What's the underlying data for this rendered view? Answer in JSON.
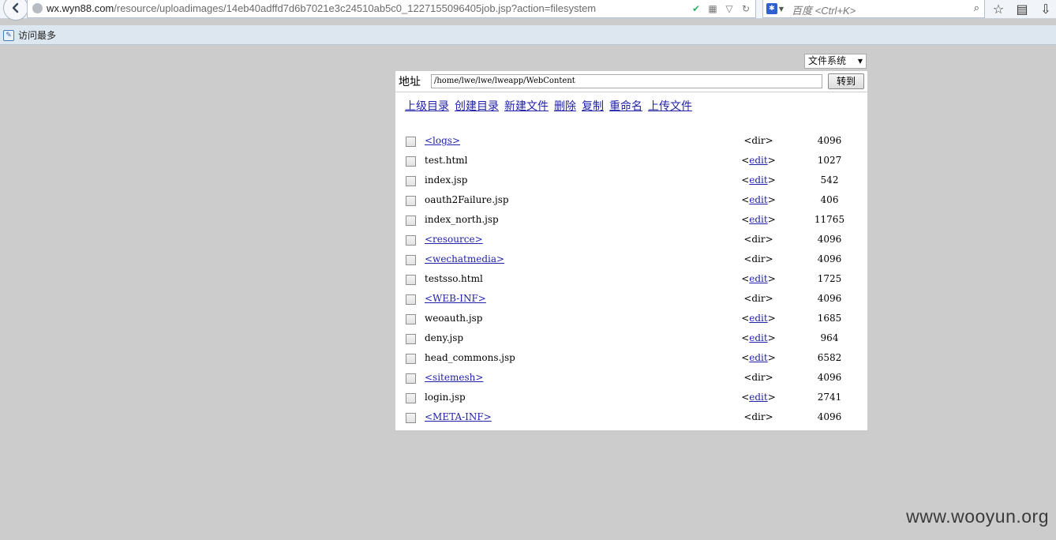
{
  "browser": {
    "url_domain": "wx.wyn88.com",
    "url_path": "/resource/uploadimages/14eb40adffd7d6b7021e3c24510ab5c0_1227155096405job.jsp?action=filesystem",
    "search_placeholder": "百度 <Ctrl+K>",
    "bookmark_label": "访问最多"
  },
  "filesystem": {
    "mode_select": "文件系统",
    "address_label": "地址",
    "address_value": "/home/lwe/lwe/lweapp/WebContent",
    "go_button": "转到",
    "actions": [
      "上级目录",
      "创建目录",
      "新建文件",
      "删除",
      "复制",
      "重命名",
      "上传文件"
    ],
    "files": [
      {
        "name": "<logs>",
        "is_dir": true,
        "type_prefix": "",
        "type_text": "<dir>",
        "type_suffix": "",
        "size": "4096"
      },
      {
        "name": "test.html",
        "is_dir": false,
        "type_prefix": "<",
        "type_text": "edit",
        "type_suffix": ">",
        "size": "1027"
      },
      {
        "name": "index.jsp",
        "is_dir": false,
        "type_prefix": "<",
        "type_text": "edit",
        "type_suffix": ">",
        "size": "542"
      },
      {
        "name": "oauth2Failure.jsp",
        "is_dir": false,
        "type_prefix": "<",
        "type_text": "edit",
        "type_suffix": ">",
        "size": "406"
      },
      {
        "name": "index_north.jsp",
        "is_dir": false,
        "type_prefix": "<",
        "type_text": "edit",
        "type_suffix": ">",
        "size": "11765"
      },
      {
        "name": "<resource>",
        "is_dir": true,
        "type_prefix": "",
        "type_text": "<dir>",
        "type_suffix": "",
        "size": "4096"
      },
      {
        "name": "<wechatmedia>",
        "is_dir": true,
        "type_prefix": "",
        "type_text": "<dir>",
        "type_suffix": "",
        "size": "4096"
      },
      {
        "name": "testsso.html",
        "is_dir": false,
        "type_prefix": "<",
        "type_text": "edit",
        "type_suffix": ">",
        "size": "1725"
      },
      {
        "name": "<WEB-INF>",
        "is_dir": true,
        "type_prefix": "",
        "type_text": "<dir>",
        "type_suffix": "",
        "size": "4096"
      },
      {
        "name": "weoauth.jsp",
        "is_dir": false,
        "type_prefix": "<",
        "type_text": "edit",
        "type_suffix": ">",
        "size": "1685"
      },
      {
        "name": "deny.jsp",
        "is_dir": false,
        "type_prefix": "<",
        "type_text": "edit",
        "type_suffix": ">",
        "size": "964"
      },
      {
        "name": "head_commons.jsp",
        "is_dir": false,
        "type_prefix": "<",
        "type_text": "edit",
        "type_suffix": ">",
        "size": "6582"
      },
      {
        "name": "<sitemesh>",
        "is_dir": true,
        "type_prefix": "",
        "type_text": "<dir>",
        "type_suffix": "",
        "size": "4096"
      },
      {
        "name": "login.jsp",
        "is_dir": false,
        "type_prefix": "<",
        "type_text": "edit",
        "type_suffix": ">",
        "size": "2741"
      },
      {
        "name": "<META-INF>",
        "is_dir": true,
        "type_prefix": "",
        "type_text": "<dir>",
        "type_suffix": "",
        "size": "4096"
      }
    ]
  },
  "watermark": "www.wooyun.org"
}
